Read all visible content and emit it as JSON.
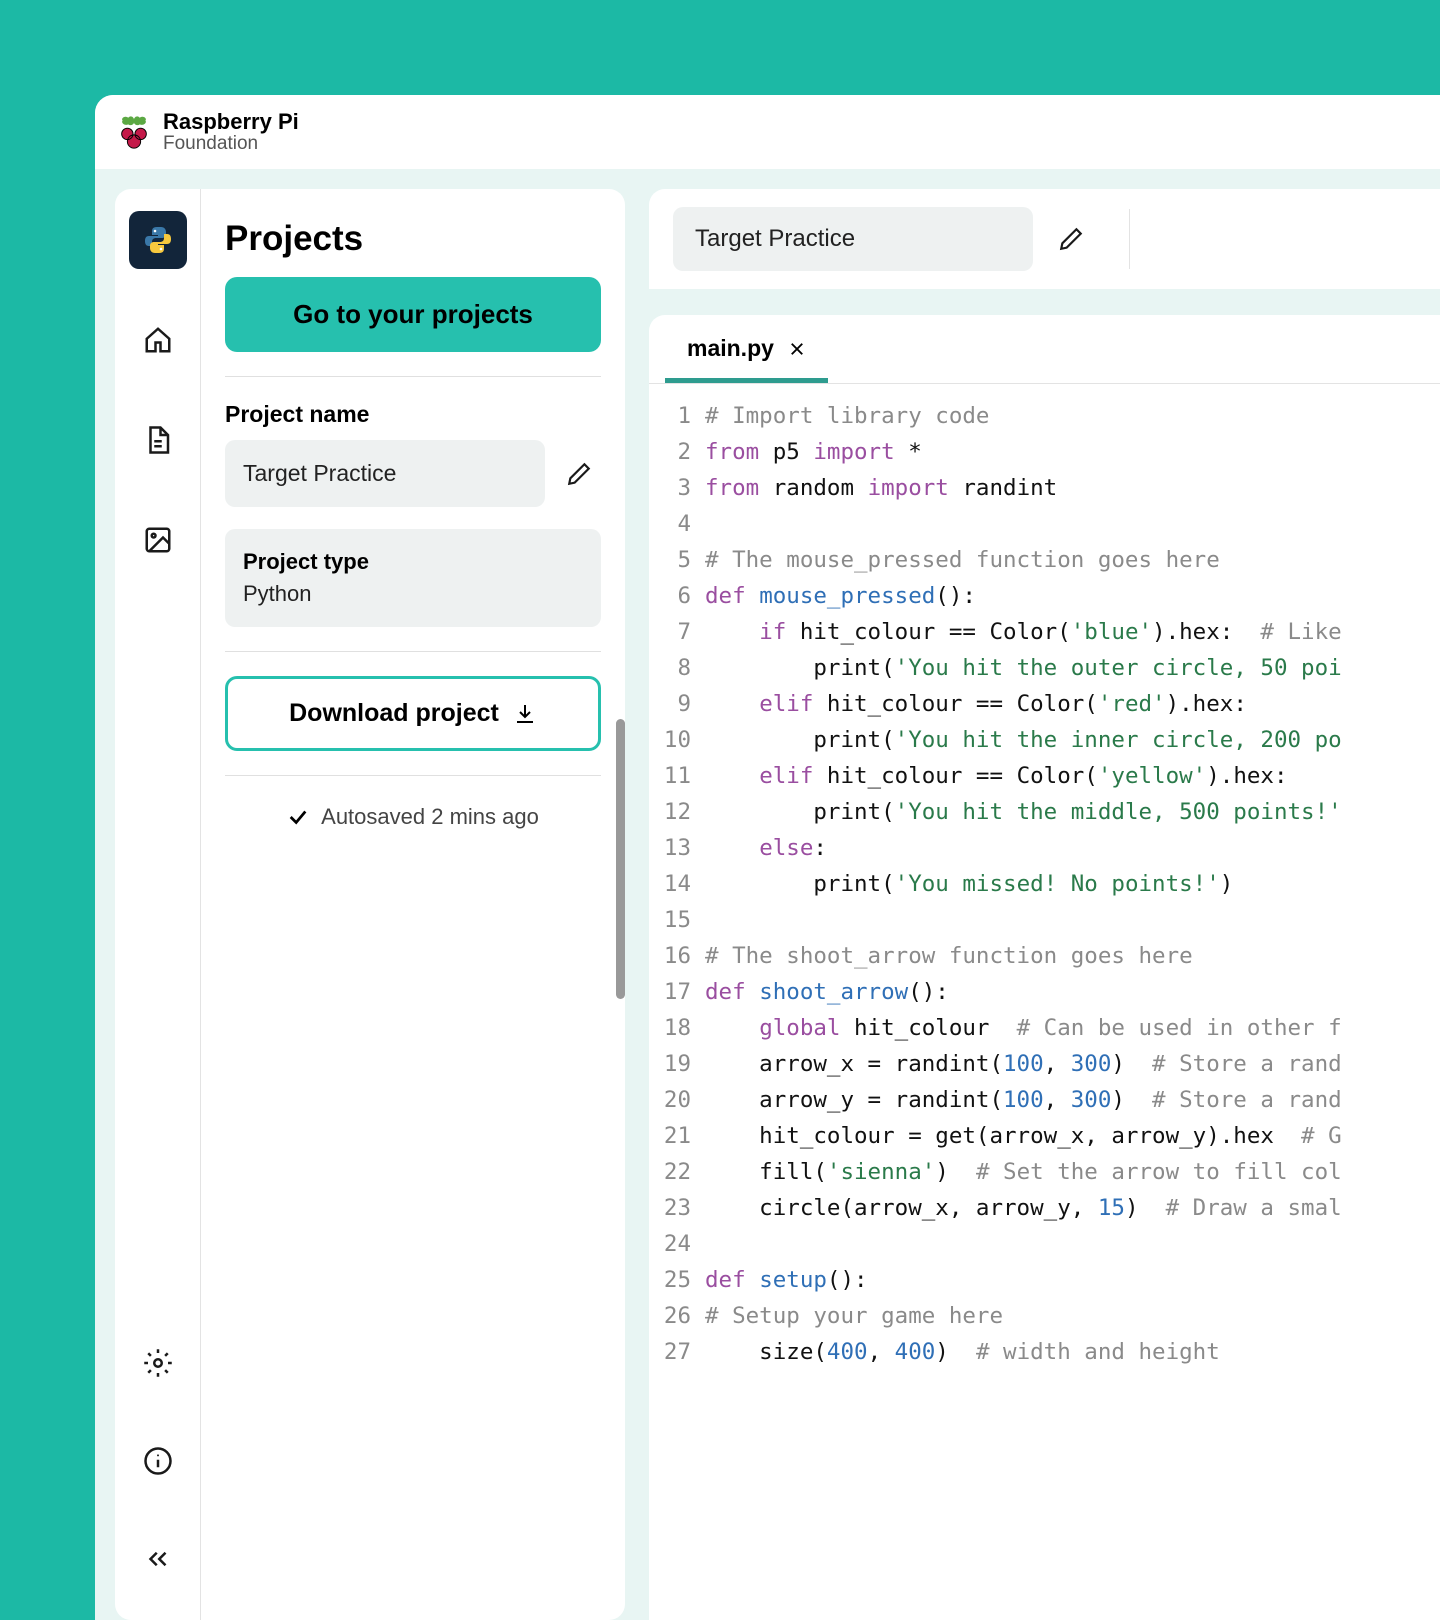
{
  "brand": {
    "line1": "Raspberry Pi",
    "line2": "Foundation"
  },
  "panel": {
    "title": "Projects",
    "go_button": "Go to your projects",
    "name_label": "Project name",
    "project_name": "Target Practice",
    "type_label": "Project type",
    "type_value": "Python",
    "download": "Download project",
    "autosaved": "Autosaved 2 mins ago"
  },
  "title_bar": {
    "project": "Target Practice"
  },
  "tabs": [
    {
      "name": "main.py"
    }
  ],
  "code": {
    "lines": [
      {
        "n": 1,
        "tokens": [
          {
            "c": "c-comment",
            "t": "# Import library code"
          }
        ]
      },
      {
        "n": 2,
        "tokens": [
          {
            "c": "c-kw",
            "t": "from"
          },
          {
            "c": "plain",
            "t": " p5 "
          },
          {
            "c": "c-kw",
            "t": "import"
          },
          {
            "c": "plain",
            "t": " *"
          }
        ]
      },
      {
        "n": 3,
        "tokens": [
          {
            "c": "c-kw",
            "t": "from"
          },
          {
            "c": "plain",
            "t": " random "
          },
          {
            "c": "c-kw",
            "t": "import"
          },
          {
            "c": "plain",
            "t": " randint"
          }
        ]
      },
      {
        "n": 4,
        "tokens": [
          {
            "c": "plain",
            "t": ""
          }
        ]
      },
      {
        "n": 5,
        "tokens": [
          {
            "c": "c-comment",
            "t": "# The mouse_pressed function goes here"
          }
        ]
      },
      {
        "n": 6,
        "tokens": [
          {
            "c": "c-kw",
            "t": "def"
          },
          {
            "c": "plain",
            "t": " "
          },
          {
            "c": "c-fn",
            "t": "mouse_pressed"
          },
          {
            "c": "plain",
            "t": "():"
          }
        ]
      },
      {
        "n": 7,
        "tokens": [
          {
            "c": "plain",
            "t": "    "
          },
          {
            "c": "c-kw",
            "t": "if"
          },
          {
            "c": "plain",
            "t": " hit_colour == Color("
          },
          {
            "c": "c-str",
            "t": "'blue'"
          },
          {
            "c": "plain",
            "t": ").hex:  "
          },
          {
            "c": "c-comment",
            "t": "# Like"
          }
        ]
      },
      {
        "n": 8,
        "tokens": [
          {
            "c": "plain",
            "t": "        print("
          },
          {
            "c": "c-str",
            "t": "'You hit the outer circle, 50 poi"
          }
        ]
      },
      {
        "n": 9,
        "tokens": [
          {
            "c": "plain",
            "t": "    "
          },
          {
            "c": "c-kw",
            "t": "elif"
          },
          {
            "c": "plain",
            "t": " hit_colour == Color("
          },
          {
            "c": "c-str",
            "t": "'red'"
          },
          {
            "c": "plain",
            "t": ").hex:"
          }
        ]
      },
      {
        "n": 10,
        "tokens": [
          {
            "c": "plain",
            "t": "        print("
          },
          {
            "c": "c-str",
            "t": "'You hit the inner circle, 200 po"
          }
        ]
      },
      {
        "n": 11,
        "tokens": [
          {
            "c": "plain",
            "t": "    "
          },
          {
            "c": "c-kw",
            "t": "elif"
          },
          {
            "c": "plain",
            "t": " hit_colour == Color("
          },
          {
            "c": "c-str",
            "t": "'yellow'"
          },
          {
            "c": "plain",
            "t": ").hex:"
          }
        ]
      },
      {
        "n": 12,
        "tokens": [
          {
            "c": "plain",
            "t": "        print("
          },
          {
            "c": "c-str",
            "t": "'You hit the middle, 500 points!'"
          }
        ]
      },
      {
        "n": 13,
        "tokens": [
          {
            "c": "plain",
            "t": "    "
          },
          {
            "c": "c-kw",
            "t": "else"
          },
          {
            "c": "plain",
            "t": ":"
          }
        ]
      },
      {
        "n": 14,
        "tokens": [
          {
            "c": "plain",
            "t": "        print("
          },
          {
            "c": "c-str",
            "t": "'You missed! No points!'"
          },
          {
            "c": "plain",
            "t": ")"
          }
        ]
      },
      {
        "n": 15,
        "tokens": [
          {
            "c": "plain",
            "t": ""
          }
        ]
      },
      {
        "n": 16,
        "tokens": [
          {
            "c": "c-comment",
            "t": "# The shoot_arrow function goes here"
          }
        ]
      },
      {
        "n": 17,
        "tokens": [
          {
            "c": "c-kw",
            "t": "def"
          },
          {
            "c": "plain",
            "t": " "
          },
          {
            "c": "c-fn",
            "t": "shoot_arrow"
          },
          {
            "c": "plain",
            "t": "():"
          }
        ]
      },
      {
        "n": 18,
        "tokens": [
          {
            "c": "plain",
            "t": "    "
          },
          {
            "c": "c-kw",
            "t": "global"
          },
          {
            "c": "plain",
            "t": " hit_colour  "
          },
          {
            "c": "c-comment",
            "t": "# Can be used in other f"
          }
        ]
      },
      {
        "n": 19,
        "tokens": [
          {
            "c": "plain",
            "t": "    arrow_x = randint("
          },
          {
            "c": "c-num",
            "t": "100"
          },
          {
            "c": "plain",
            "t": ", "
          },
          {
            "c": "c-num",
            "t": "300"
          },
          {
            "c": "plain",
            "t": ")  "
          },
          {
            "c": "c-comment",
            "t": "# Store a rand"
          }
        ]
      },
      {
        "n": 20,
        "tokens": [
          {
            "c": "plain",
            "t": "    arrow_y = randint("
          },
          {
            "c": "c-num",
            "t": "100"
          },
          {
            "c": "plain",
            "t": ", "
          },
          {
            "c": "c-num",
            "t": "300"
          },
          {
            "c": "plain",
            "t": ")  "
          },
          {
            "c": "c-comment",
            "t": "# Store a rand"
          }
        ]
      },
      {
        "n": 21,
        "tokens": [
          {
            "c": "plain",
            "t": "    hit_colour = get(arrow_x, arrow_y).hex  "
          },
          {
            "c": "c-comment",
            "t": "# G"
          }
        ]
      },
      {
        "n": 22,
        "tokens": [
          {
            "c": "plain",
            "t": "    fill("
          },
          {
            "c": "c-str",
            "t": "'sienna'"
          },
          {
            "c": "plain",
            "t": ")  "
          },
          {
            "c": "c-comment",
            "t": "# Set the arrow to fill col"
          }
        ]
      },
      {
        "n": 23,
        "tokens": [
          {
            "c": "plain",
            "t": "    circle(arrow_x, arrow_y, "
          },
          {
            "c": "c-num",
            "t": "15"
          },
          {
            "c": "plain",
            "t": ")  "
          },
          {
            "c": "c-comment",
            "t": "# Draw a smal"
          }
        ]
      },
      {
        "n": 24,
        "tokens": [
          {
            "c": "plain",
            "t": ""
          }
        ]
      },
      {
        "n": 25,
        "tokens": [
          {
            "c": "c-kw",
            "t": "def"
          },
          {
            "c": "plain",
            "t": " "
          },
          {
            "c": "c-fn",
            "t": "setup"
          },
          {
            "c": "plain",
            "t": "():"
          }
        ]
      },
      {
        "n": 26,
        "tokens": [
          {
            "c": "c-comment",
            "t": "# Setup your game here"
          }
        ]
      },
      {
        "n": 27,
        "tokens": [
          {
            "c": "plain",
            "t": "    size("
          },
          {
            "c": "c-num",
            "t": "400"
          },
          {
            "c": "plain",
            "t": ", "
          },
          {
            "c": "c-num",
            "t": "400"
          },
          {
            "c": "plain",
            "t": ")  "
          },
          {
            "c": "c-comment",
            "t": "# width and height"
          }
        ]
      }
    ]
  }
}
